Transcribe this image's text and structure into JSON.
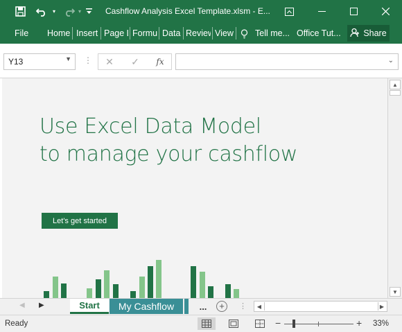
{
  "window": {
    "title": "Cashflow Analysis Excel Template.xlsm - E..."
  },
  "quick_access": {
    "icons": [
      "save-icon",
      "undo-icon",
      "redo-icon",
      "customize-icon"
    ]
  },
  "window_controls": {
    "icons": [
      "ribbon-display-icon",
      "minimize-icon",
      "maximize-icon",
      "close-icon"
    ]
  },
  "ribbon": {
    "tabs": [
      "File",
      "Home",
      "Insert",
      "Page L",
      "Formu",
      "Data",
      "Review",
      "View",
      "Tell me...",
      "Office Tut..."
    ],
    "share_label": "Share"
  },
  "formula_bar": {
    "name_box": "Y13",
    "fx_label": "fx",
    "formula": ""
  },
  "sheet": {
    "headline_line1": "Use Excel Data Model",
    "headline_line2": "to manage your cashflow",
    "start_button": "Let's get started",
    "bar_chart": {
      "colors": {
        "dark": "#217346",
        "light": "#84c58a"
      },
      "bars": [
        {
          "v": 10,
          "c": "dark"
        },
        {
          "v": 31,
          "c": "light"
        },
        {
          "v": 21,
          "c": "dark"
        },
        {
          "v": 14,
          "c": "light"
        },
        {
          "v": 27,
          "c": "dark"
        },
        {
          "v": 40,
          "c": "light"
        },
        {
          "v": 20,
          "c": "dark"
        },
        {
          "v": 10,
          "c": "dark"
        },
        {
          "v": 31,
          "c": "light"
        },
        {
          "v": 46,
          "c": "dark"
        },
        {
          "v": 55,
          "c": "light"
        },
        {
          "v": 46,
          "c": "dark"
        },
        {
          "v": 38,
          "c": "light"
        },
        {
          "v": 17,
          "c": "dark"
        },
        {
          "v": 20,
          "c": "dark"
        },
        {
          "v": 13,
          "c": "light"
        }
      ]
    }
  },
  "sheet_tabs": {
    "tabs": [
      "Start",
      "My Cashflow"
    ],
    "more_label": "...",
    "active": "Start"
  },
  "status_bar": {
    "status": "Ready",
    "zoom_level": "33%"
  },
  "colors": {
    "accent": "#217346",
    "tab_teal": "#3a8f96"
  }
}
